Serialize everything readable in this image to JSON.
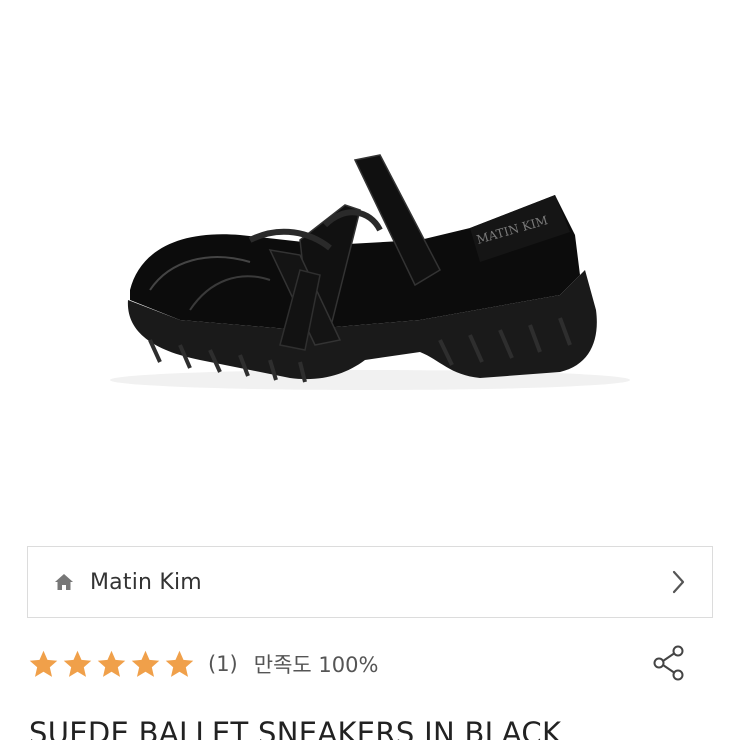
{
  "product": {
    "image_alt": "suede-ballet-sneaker-image",
    "title": "SUEDE BALLET SNEAKERS IN BLACK"
  },
  "brand": {
    "name": "Matin Kim",
    "shoe_logo_text": "MATIN KIM",
    "icon": "home-icon",
    "chevron": "chevron-right-icon"
  },
  "rating": {
    "stars": 5,
    "count": "(1)",
    "satisfaction": "만족도 100%",
    "star_color": "#f0a04a"
  },
  "actions": {
    "share_icon": "share-icon"
  }
}
